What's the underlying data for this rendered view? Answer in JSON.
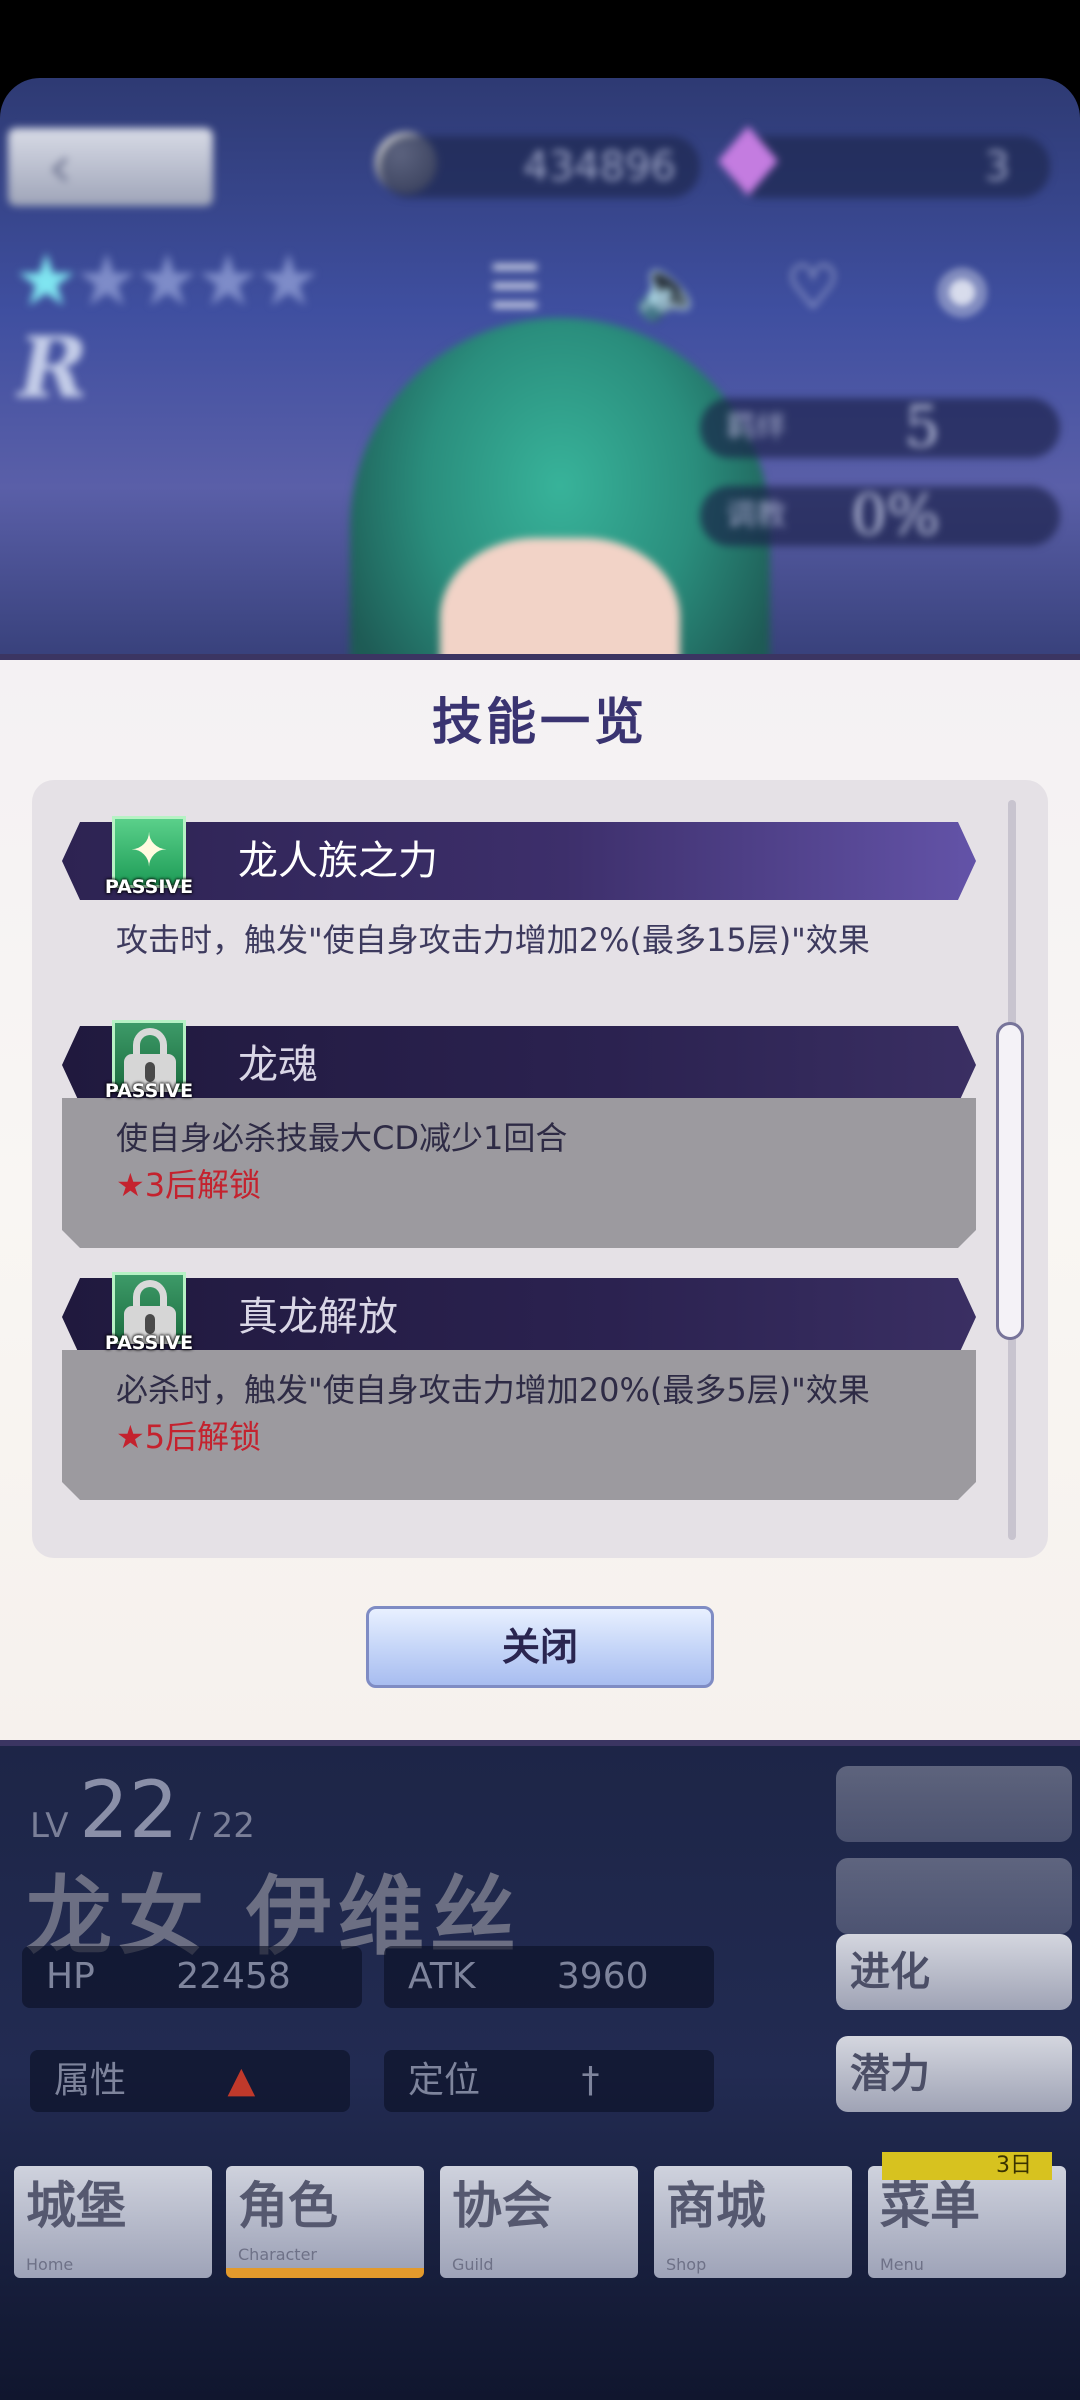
{
  "top": {
    "coins": "434896",
    "gems": "3",
    "rarity": "R",
    "stars_filled": 1,
    "stars_total": 5,
    "stats": [
      {
        "label": "羁绊",
        "value": "5"
      },
      {
        "label": "调教",
        "value": "0%"
      }
    ]
  },
  "modal": {
    "title": "技能一览",
    "skills": [
      {
        "name": "龙人族之力",
        "badge": "PASSIVE",
        "locked": false,
        "description": "攻击时，触发\"使自身攻击力增加2%(最多15层)\"效果",
        "unlock": ""
      },
      {
        "name": "龙魂",
        "badge": "PASSIVE",
        "locked": true,
        "description": "使自身必杀技最大CD减少1回合",
        "unlock": "★3后解锁"
      },
      {
        "name": "真龙解放",
        "badge": "PASSIVE",
        "locked": true,
        "description": "必杀时，触发\"使自身攻击力增加20%(最多5层)\"效果",
        "unlock": "★5后解锁"
      }
    ],
    "close_label": "关闭"
  },
  "bottom": {
    "lv_label": "LV",
    "lv": "22",
    "lv_max": "/ 22",
    "char_name": "龙女 伊维丝",
    "hp_label": "HP",
    "hp": "22458",
    "atk_label": "ATK",
    "atk": "3960",
    "attr_label": "属性",
    "role_label": "定位",
    "side_buttons": [
      "进化",
      "潜力"
    ],
    "nav": [
      {
        "label": "城堡",
        "sub": "Home"
      },
      {
        "label": "角色",
        "sub": "Character"
      },
      {
        "label": "协会",
        "sub": "Guild"
      },
      {
        "label": "商城",
        "sub": "Shop"
      },
      {
        "label": "菜单",
        "sub": "Menu"
      }
    ],
    "nav_badge": "3日"
  }
}
